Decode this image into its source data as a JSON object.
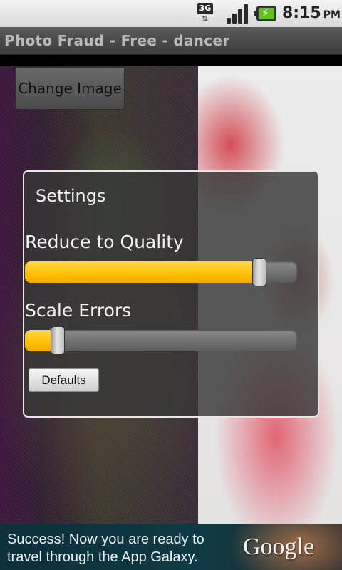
{
  "status_bar": {
    "network_label": "3G",
    "network_icon": "network-3g-icon",
    "signal_icon": "signal-strength-icon",
    "battery_icon": "battery-charging-icon",
    "time": "8:15",
    "ampm": "PM"
  },
  "app": {
    "title": "Photo Fraud - Free - dancer"
  },
  "main": {
    "change_image_label": "Change Image"
  },
  "settings": {
    "title": "Settings",
    "reduce_quality_label": "Reduce to Quality",
    "reduce_quality_level": 0.86,
    "scale_errors_label": "Scale Errors",
    "scale_errors_level": 0.12,
    "defaults_label": "Defaults",
    "accent_color": "#ffbf00"
  },
  "ad": {
    "text": "Success! Now you are ready to travel through the App Galaxy.",
    "logo": "Google"
  }
}
